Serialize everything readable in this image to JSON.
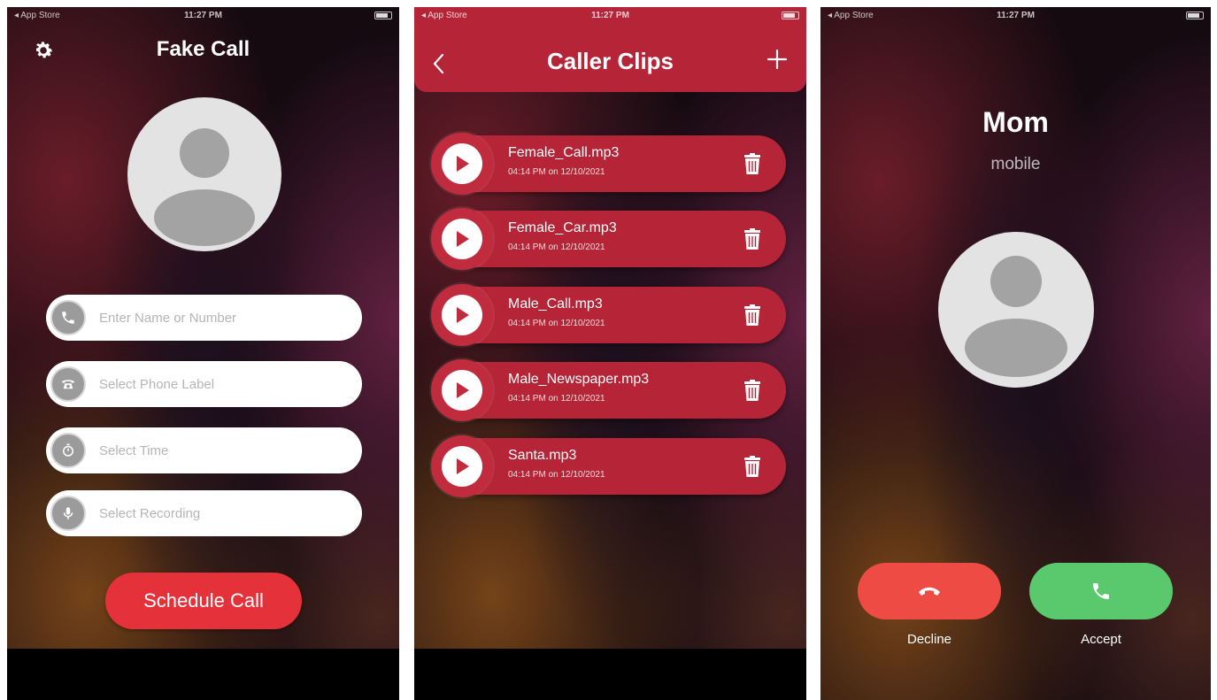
{
  "status_bar": {
    "carrier": "◂ App Store",
    "time": "11:27 PM"
  },
  "screen_fake_call": {
    "title": "Fake Call",
    "fields": [
      {
        "placeholder": "Enter Name or Number",
        "icon": "phone-icon"
      },
      {
        "placeholder": "Select Phone Label",
        "icon": "telephone-icon"
      },
      {
        "placeholder": "Select Time",
        "icon": "timer-icon"
      },
      {
        "placeholder": "Select Recording",
        "icon": "microphone-icon"
      }
    ],
    "schedule_label": "Schedule Call"
  },
  "screen_caller_clips": {
    "title": "Caller Clips",
    "clips": [
      {
        "name": "Female_Call.mp3",
        "date": "04:14 PM on 12/10/2021"
      },
      {
        "name": "Female_Car.mp3",
        "date": "04:14 PM on 12/10/2021"
      },
      {
        "name": "Male_Call.mp3",
        "date": "04:14 PM on 12/10/2021"
      },
      {
        "name": "Male_Newspaper.mp3",
        "date": "04:14 PM on 12/10/2021"
      },
      {
        "name": "Santa.mp3",
        "date": "04:14 PM on 12/10/2021"
      }
    ]
  },
  "screen_incoming_call": {
    "caller_name": "Mom",
    "caller_label": "mobile",
    "decline_label": "Decline",
    "accept_label": "Accept"
  },
  "colors": {
    "accent_red": "#b52537",
    "schedule_red": "#e5313a",
    "decline_red": "#ee4b45",
    "accept_green": "#5ac96d"
  }
}
